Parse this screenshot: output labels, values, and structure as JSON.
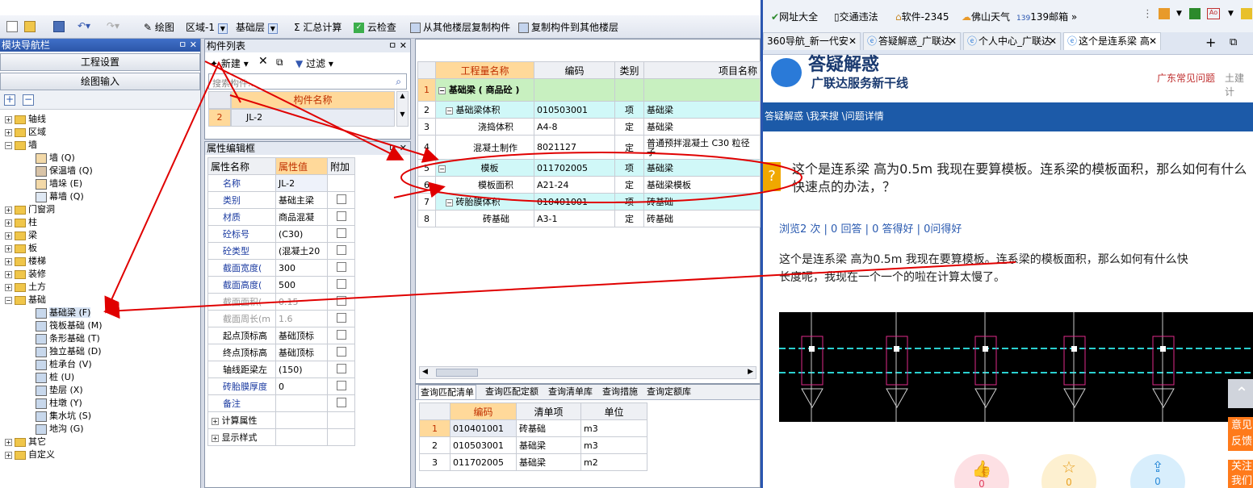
{
  "toolbar": {
    "draw": "绘图",
    "region": "区域-1",
    "layer": "基础层",
    "sum": "汇总计算",
    "cloud": "云检查",
    "copy_from": "从其他楼层复制构件",
    "copy_to": "复制构件到其他楼层"
  },
  "nav": {
    "title": "模块导航栏",
    "pin": "ㅁ ✕",
    "btn1": "工程设置",
    "btn2": "绘图输入",
    "items": [
      "轴线",
      "区域",
      "墙",
      "墙 (Q)",
      "保温墙 (Q)",
      "墙垛 (E)",
      "幕墙 (Q)",
      "门窗洞",
      "柱",
      "梁",
      "板",
      "楼梯",
      "装修",
      "土方",
      "基础",
      "基础梁 (F)",
      "筏板基础 (M)",
      "条形基础 (T)",
      "独立基础 (D)",
      "桩承台 (V)",
      "桩 (U)",
      "垫层 (X)",
      "柱墩 (Y)",
      "集水坑 (S)",
      "地沟 (G)",
      "其它",
      "自定义"
    ]
  },
  "comp": {
    "title": "构件列表",
    "new": "新建",
    "filter": "过滤",
    "search": "搜索构件...",
    "header": "构件名称",
    "row_num": "2",
    "row_name": "JL-2"
  },
  "attr": {
    "title": "属性编辑框",
    "h1": "属性名称",
    "h2": "属性值",
    "h3": "附加",
    "rows": [
      [
        "名称",
        "JL-2"
      ],
      [
        "类别",
        "基础主梁"
      ],
      [
        "材质",
        "商品混凝"
      ],
      [
        "砼标号",
        "(C30)"
      ],
      [
        "砼类型",
        "(混凝土20"
      ],
      [
        "截面宽度(",
        "300"
      ],
      [
        "截面高度(",
        "500"
      ],
      [
        "截面面积(",
        "0.15"
      ],
      [
        "截面周长(m",
        "1.6"
      ],
      [
        "起点顶标高",
        "基础顶标"
      ],
      [
        "终点顶标高",
        "基础顶标"
      ],
      [
        "轴线距梁左",
        "(150)"
      ],
      [
        "砖胎膜厚度",
        "0"
      ],
      [
        "备注",
        ""
      ]
    ],
    "calc": "计算属性",
    "show": "显示样式"
  },
  "qty": {
    "headers": [
      "工程量名称",
      "编码",
      "类别",
      "项目名称"
    ],
    "rows": [
      [
        "1",
        "基础梁 ( 商品砼 )",
        "",
        "",
        ""
      ],
      [
        "2",
        "基础梁体积",
        "010503001",
        "项",
        "基础梁"
      ],
      [
        "3",
        "浇捣体积",
        "A4-8",
        "定",
        "基础梁"
      ],
      [
        "4",
        "混凝土制作",
        "8021127",
        "定",
        "普通预拌混凝土 C30 粒径 子"
      ],
      [
        "5",
        "模板",
        "011702005",
        "项",
        "基础梁"
      ],
      [
        "6",
        "模板面积",
        "A21-24",
        "定",
        "基础梁模板"
      ],
      [
        "7",
        "砖胎膜体积",
        "010401001",
        "项",
        "砖基础"
      ],
      [
        "8",
        "砖基础",
        "A3-1",
        "定",
        "砖基础"
      ]
    ]
  },
  "query": {
    "tabs": [
      "查询匹配清单",
      "查询匹配定额",
      "查询清单库",
      "查询措施",
      "查询定额库"
    ],
    "headers": [
      "编码",
      "清单项",
      "单位"
    ],
    "rows": [
      [
        "1",
        "010401001",
        "砖基础",
        "m3"
      ],
      [
        "2",
        "010503001",
        "基础梁",
        "m3"
      ],
      [
        "3",
        "011702005",
        "基础梁",
        "m2"
      ]
    ]
  },
  "browser": {
    "bookmarks": [
      "网址大全",
      "交通违法",
      "软件-2345",
      "佛山天气",
      "139邮箱"
    ],
    "tabs": [
      "360导航_新一代安",
      "答疑解惑_广联达",
      "个人中心_广联达",
      "这个是连系梁 高"
    ],
    "logo": "答疑解惑",
    "slogan": "广联达服务新干线",
    "links": [
      "广东常见问题",
      "土建计"
    ],
    "breadcrumb": "答疑解惑 \\我来搜 \\问题详情",
    "question": "这个是连系梁 高为0.5m 我现在要算模板。连系梁的模板面积，那么如何有什么快速点的办法，？",
    "stats": "浏览2 次 | 0 回答 | 0 答得好 | 0问得好",
    "body1": "这个是连系梁  高为0.5m   我现在要算模板。连系梁的模板面积，那么如何有什么快",
    "body2": "长度呢，我现在一个一个的啦在计算太慢了。",
    "side1": "意见反馈",
    "side2": "关注我们",
    "counts": [
      "0",
      "0",
      "0"
    ]
  },
  "colors": {
    "title": "#2c56a8",
    "accent": "#e00000",
    "header": "#ffd99a",
    "rowgreen": "#c8f0c0",
    "rowcyan": "#d0f8f8"
  }
}
